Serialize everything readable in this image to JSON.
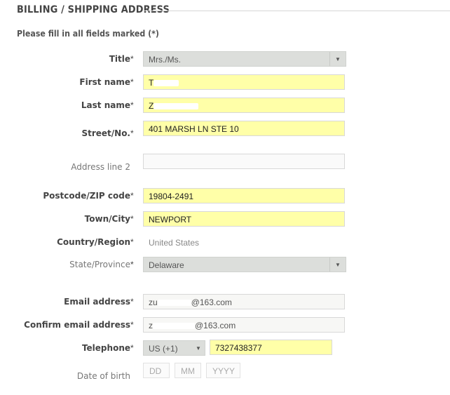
{
  "section": {
    "title": "BILLING / SHIPPING ADDRESS",
    "hint": "Please fill in all fields marked (*)"
  },
  "required_mark": "*",
  "fields": {
    "title": {
      "label": "Title",
      "value": "Mrs./Ms."
    },
    "first_name": {
      "label": "First name",
      "value": "T"
    },
    "last_name": {
      "label": "Last name",
      "value": "Z"
    },
    "street": {
      "label": "Street/No.",
      "value": "401 MARSH LN STE 10"
    },
    "address2": {
      "label": "Address line 2",
      "value": ""
    },
    "postcode": {
      "label": "Postcode/ZIP code",
      "value": "19804-2491"
    },
    "town": {
      "label": "Town/City",
      "value": "NEWPORT"
    },
    "country": {
      "label": "Country/Region",
      "value": "United States"
    },
    "state": {
      "label": "State/Province",
      "value": "Delaware"
    },
    "email": {
      "label": "Email address",
      "value_prefix": "zu",
      "value": "@163.com"
    },
    "confirm_email": {
      "label": "Confirm email address",
      "value_prefix": "z",
      "value": "@163.com"
    },
    "telephone": {
      "label": "Telephone",
      "country_code": "US (+1)",
      "value": "7327438377"
    },
    "dob": {
      "label": "Date of birth",
      "dd": "DD",
      "mm": "MM",
      "yyyy": "YYYY"
    }
  },
  "icons": {
    "dropdown": "chevron-down-icon"
  }
}
